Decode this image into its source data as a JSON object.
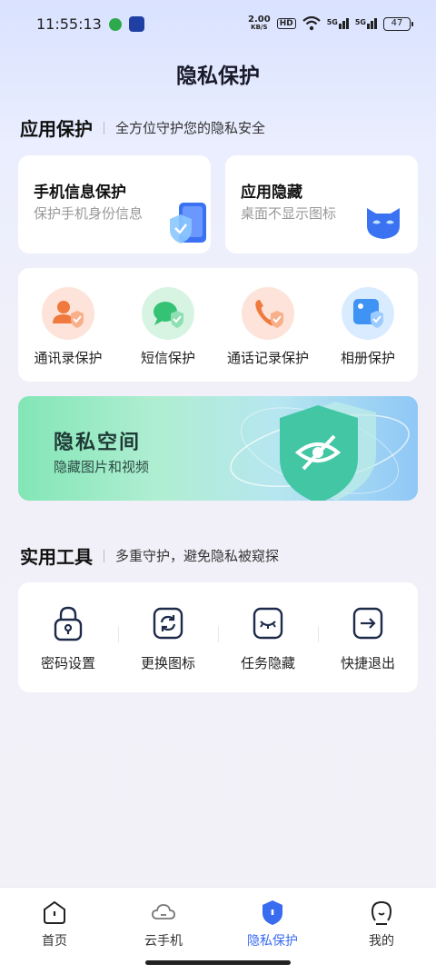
{
  "status": {
    "time": "11:55:13",
    "speed_value": "2.00",
    "speed_unit": "KB/S",
    "hd": "HD",
    "net1": "5G",
    "net2": "5G",
    "battery": "47"
  },
  "page_title": "隐私保护",
  "app_protect": {
    "title": "应用保护",
    "subtitle": "全方位守护您的隐私安全",
    "cards": [
      {
        "title": "手机信息保护",
        "desc": "保护手机身份信息",
        "icon": "phone-shield-icon"
      },
      {
        "title": "应用隐藏",
        "desc": "桌面不显示图标",
        "icon": "mask-icon"
      }
    ],
    "items": [
      {
        "label": "通讯录保护",
        "icon": "contacts-shield-icon"
      },
      {
        "label": "短信保护",
        "icon": "message-shield-icon"
      },
      {
        "label": "通话记录保护",
        "icon": "call-log-shield-icon"
      },
      {
        "label": "相册保护",
        "icon": "album-shield-icon"
      }
    ]
  },
  "private_space": {
    "title": "隐私空间",
    "desc": "隐藏图片和视频",
    "icon": "eye-off-shield-icon"
  },
  "tools": {
    "title": "实用工具",
    "subtitle": "多重守护，避免隐私被窥探",
    "items": [
      {
        "label": "密码设置",
        "icon": "lock-icon"
      },
      {
        "label": "更换图标",
        "icon": "refresh-icon"
      },
      {
        "label": "任务隐藏",
        "icon": "closed-eye-icon"
      },
      {
        "label": "快捷退出",
        "icon": "exit-icon"
      }
    ]
  },
  "tabbar": {
    "items": [
      {
        "label": "首页",
        "icon": "home-icon"
      },
      {
        "label": "云手机",
        "icon": "cloud-icon"
      },
      {
        "label": "隐私保护",
        "icon": "shield-icon"
      },
      {
        "label": "我的",
        "icon": "person-icon"
      }
    ],
    "active_index": 2
  },
  "colors": {
    "accent": "#3a6cf0",
    "green": "#3cc47a",
    "orange": "#f0793e"
  }
}
